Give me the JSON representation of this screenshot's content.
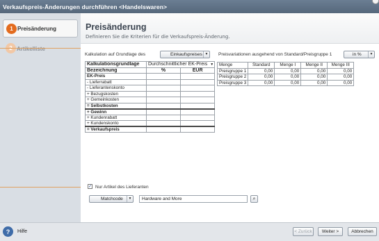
{
  "window": {
    "title": "Verkaufspreis-Änderungen durchführen <Handelswaren>"
  },
  "wizard": {
    "steps": [
      {
        "number": "1",
        "label": "Preisänderung",
        "active": true
      },
      {
        "number": "2",
        "label": "Artikelliste",
        "active": false
      }
    ]
  },
  "header": {
    "title": "Preisänderung",
    "subtitle": "Definieren Sie die Kriterien für die Verkaufspreis-Änderung."
  },
  "calc": {
    "label": "Kalkulation auf Grundlage des",
    "basis_button": "Einkaufspreises"
  },
  "kalk_table": {
    "header_label": "Kalkulationsgrundlage",
    "header_select": "Durchschnittlicher EK-Preis",
    "col_headers": [
      "Bezeichnung",
      "%",
      "EUR"
    ],
    "rows": [
      {
        "label": "EK-Preis",
        "bold": true
      },
      {
        "label": "- Lieferrabatt"
      },
      {
        "label": "- Lieferantenskonto"
      },
      {
        "label": "+ Bezugskosten"
      },
      {
        "label": "+ Gemeinkosten"
      },
      {
        "label": "= Selbstkosten",
        "bold": true
      },
      {
        "label": "+ Gewinn",
        "bold": true,
        "thick": true
      },
      {
        "label": "+ Kundenrabatt"
      },
      {
        "label": "+ Kundenskonto"
      },
      {
        "label": "= Verkaufspreis",
        "bold": true,
        "thick": true
      }
    ]
  },
  "price_var": {
    "label": "Preisvariationen ausgehend von Standard/Preisgruppe 1",
    "unit_button": "in %",
    "columns": [
      "Menge",
      "Standard",
      "Menge I",
      "Menge II",
      "Menge III"
    ],
    "rows": [
      {
        "name": "Preisgruppe 1",
        "values": [
          "0,00",
          "0,00",
          "0,00",
          "0,00"
        ]
      },
      {
        "name": "Preisgruppe 2",
        "values": [
          "0,00",
          "0,00",
          "0,00",
          "0,00"
        ]
      },
      {
        "name": "Preisgruppe 3",
        "values": [
          "0,00",
          "0,00",
          "0,00",
          "0,00"
        ]
      }
    ]
  },
  "filter": {
    "checkbox_label": "Nur Artikel des Lieferanten",
    "checked": true,
    "matchcode_button": "Matchcode",
    "supplier_value": "Hardware and More"
  },
  "footer": {
    "help_label": "Hilfe",
    "back_label": "< Zurück",
    "next_label": "Weiter >",
    "cancel_label": "Abbrechen"
  },
  "colors": {
    "titlebar": "#5f7186",
    "sidebar": "#d9dee4",
    "step_active": "#e36b1e",
    "accent_line": "#e0a161"
  }
}
